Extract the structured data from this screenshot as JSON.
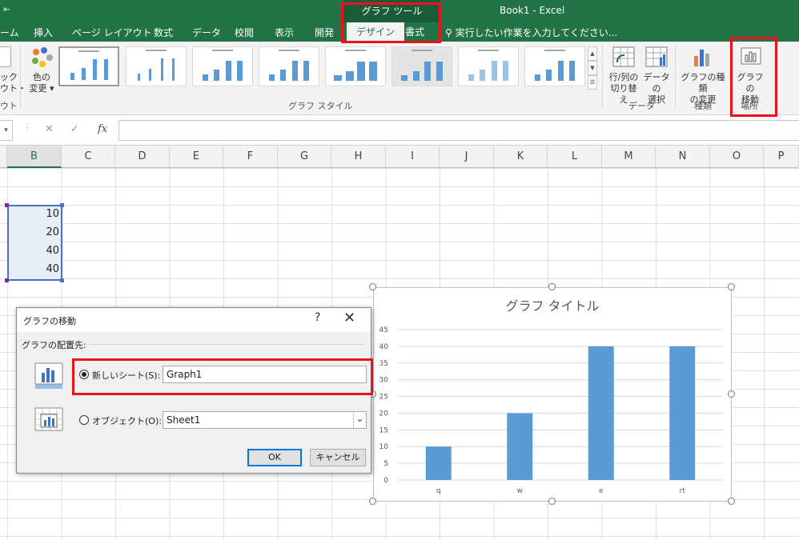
{
  "window": {
    "qat_glyph": "⇤",
    "contextual_group": "グラフ ツール",
    "title": "Book1 - Excel"
  },
  "tabs": [
    {
      "label": "ーム"
    },
    {
      "label": "挿入"
    },
    {
      "label": "ページ レイアウト"
    },
    {
      "label": "数式"
    },
    {
      "label": "データ"
    },
    {
      "label": "校閲"
    },
    {
      "label": "表示"
    },
    {
      "label": "開発"
    },
    {
      "label": "デザイン"
    },
    {
      "label": "書式"
    }
  ],
  "tell_me": "実行したい作業を入力してください...",
  "ribbon": {
    "quick_layout_label_1": "ック",
    "quick_layout_label_2": "ウト・",
    "quick_layout_group": "ウト",
    "change_colors_label_1": "色の",
    "change_colors_label_2": "変更 ▾",
    "chart_styles_group": "グラフ スタイル",
    "switch_row_col_1": "行/列の",
    "switch_row_col_2": "切り替え",
    "select_data_1": "データの",
    "select_data_2": "選択",
    "data_group": "データ",
    "change_type_1": "グラフの種類",
    "change_type_2": "の変更",
    "type_group": "種類",
    "move_chart_1": "グラフの",
    "move_chart_2": "移動",
    "location_group": "場所"
  },
  "formula_bar": {
    "namebox_arrow": "▾",
    "cancel": "✕",
    "enter": "✓",
    "fx": "fx"
  },
  "columns": [
    "B",
    "C",
    "D",
    "E",
    "F",
    "G",
    "H",
    "I",
    "J",
    "K",
    "L",
    "M",
    "N",
    "O",
    "P"
  ],
  "cells": [
    "10",
    "20",
    "40",
    "40"
  ],
  "dialog": {
    "title": "グラフの移動",
    "help": "?",
    "close": "✕",
    "section": "グラフの配置先:",
    "new_sheet_label": "新しいシート(S):",
    "new_sheet_value": "Graph1",
    "object_label": "オブジェクト(O):",
    "object_value": "Sheet1",
    "dropdown_arrow": "⌄",
    "ok": "OK",
    "cancel": "キャンセル"
  },
  "chart_data": {
    "type": "bar",
    "title": "グラフ タイトル",
    "categories": [
      "q",
      "w",
      "e",
      "rt"
    ],
    "values": [
      10,
      20,
      40,
      40
    ],
    "ylim": [
      0,
      45
    ],
    "yticks": [
      0,
      5,
      10,
      15,
      20,
      25,
      30,
      35,
      40,
      45
    ],
    "grid": true,
    "bar_color": "#5b9bd5"
  },
  "colors": {
    "excel_green": "#217346",
    "highlight": "#e8131b",
    "selection": "#4472c4"
  }
}
